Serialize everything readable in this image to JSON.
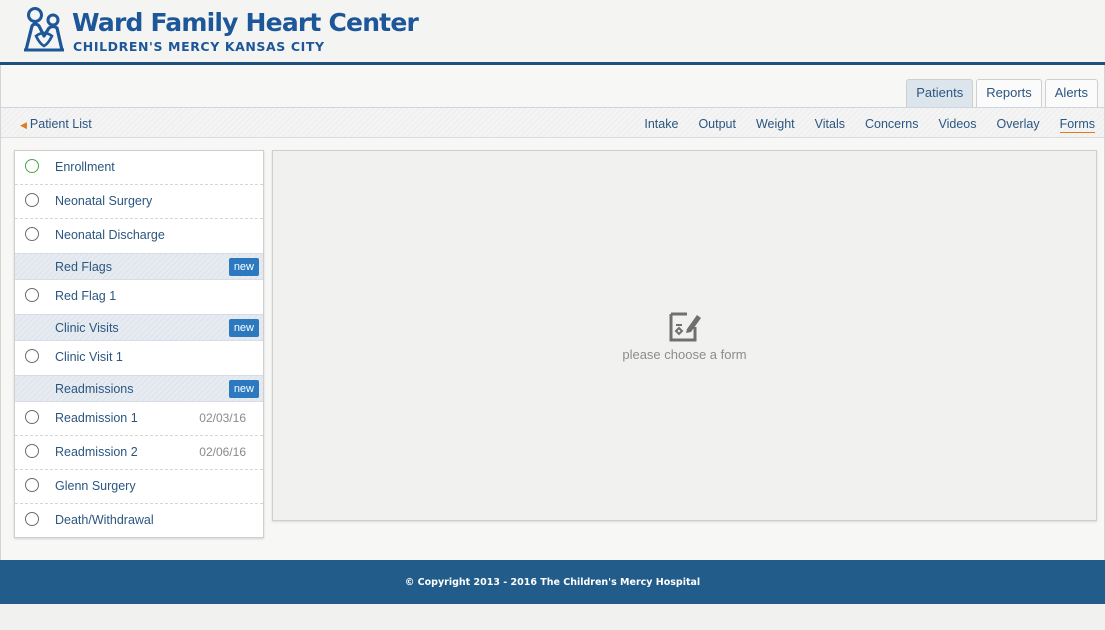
{
  "header": {
    "title": "Ward Family Heart Center",
    "subtitle": "CHILDREN'S MERCY KANSAS CITY"
  },
  "tabs": [
    {
      "label": "Patients",
      "active": true
    },
    {
      "label": "Reports",
      "active": false
    },
    {
      "label": "Alerts",
      "active": false
    }
  ],
  "subnav": {
    "back_label": "Patient List",
    "links": [
      "Intake",
      "Output",
      "Weight",
      "Vitals",
      "Concerns",
      "Videos",
      "Overlay",
      "Forms"
    ],
    "active": "Forms"
  },
  "forms": {
    "enrollment": "Enrollment",
    "neonatal_surgery": "Neonatal Surgery",
    "neonatal_discharge": "Neonatal Discharge",
    "red_flags": {
      "label": "Red Flags",
      "new_label": "new"
    },
    "red_flag_1": "Red Flag 1",
    "clinic_visits": {
      "label": "Clinic Visits",
      "new_label": "new"
    },
    "clinic_visit_1": "Clinic Visit 1",
    "readmissions": {
      "label": "Readmissions",
      "new_label": "new"
    },
    "readmission_1": {
      "label": "Readmission 1",
      "date": "02/03/16"
    },
    "readmission_2": {
      "label": "Readmission 2",
      "date": "02/06/16"
    },
    "glenn_surgery": "Glenn Surgery",
    "death_withdrawal": "Death/Withdrawal"
  },
  "content": {
    "empty_text": "please choose a form"
  },
  "footer": {
    "copyright": "© Copyright 2013 - 2016 The Children's Mercy Hospital"
  },
  "colors": {
    "brand_blue": "#1d5799",
    "footer_blue": "#215c8a",
    "accent_orange": "#e07b1a",
    "new_button": "#2c79c0"
  }
}
